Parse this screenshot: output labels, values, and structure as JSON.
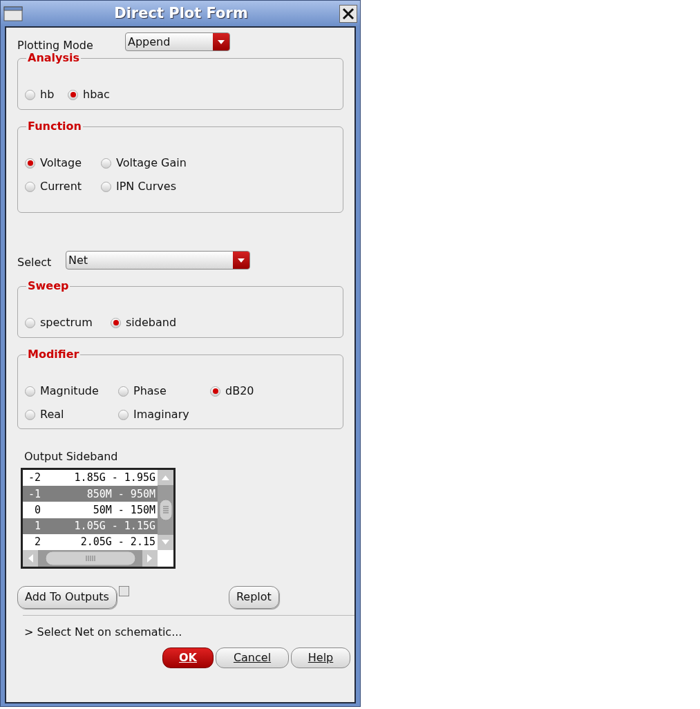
{
  "window": {
    "title": "Direct Plot Form"
  },
  "plotting_mode": {
    "label": "Plotting Mode",
    "value": "Append"
  },
  "analysis": {
    "title": "Analysis",
    "options": [
      {
        "label": "hb",
        "selected": false
      },
      {
        "label": "hbac",
        "selected": true
      }
    ]
  },
  "function": {
    "title": "Function",
    "options": [
      {
        "label": "Voltage",
        "selected": true
      },
      {
        "label": "Voltage Gain",
        "selected": false
      },
      {
        "label": "Current",
        "selected": false
      },
      {
        "label": "IPN Curves",
        "selected": false
      }
    ]
  },
  "select": {
    "label": "Select",
    "value": "Net"
  },
  "sweep": {
    "title": "Sweep",
    "options": [
      {
        "label": "spectrum",
        "selected": false
      },
      {
        "label": "sideband",
        "selected": true
      }
    ]
  },
  "modifier": {
    "title": "Modifier",
    "options": [
      {
        "label": "Magnitude",
        "selected": false
      },
      {
        "label": "Phase",
        "selected": false
      },
      {
        "label": "dB20",
        "selected": true
      },
      {
        "label": "Real",
        "selected": false
      },
      {
        "label": "Imaginary",
        "selected": false
      }
    ]
  },
  "output_sideband": {
    "label": "Output Sideband",
    "rows": [
      {
        "index": "-2",
        "range": "1.85G - 1.95G",
        "selected": false
      },
      {
        "index": "-1",
        "range": "850M - 950M",
        "selected": true
      },
      {
        "index": "0",
        "range": "50M - 150M",
        "selected": false
      },
      {
        "index": "1",
        "range": "1.05G - 1.15G",
        "selected": true
      },
      {
        "index": "2",
        "range": "2.05G - 2.15",
        "selected": false
      }
    ]
  },
  "add_to_outputs": {
    "label": "Add To Outputs",
    "checked": false
  },
  "replot": "Replot",
  "status": "> Select Net on schematic...",
  "buttons": [
    {
      "label": "OK",
      "kind": "primary"
    },
    {
      "label": "Cancel",
      "kind": "normal"
    },
    {
      "label": "Help",
      "kind": "normal"
    }
  ]
}
